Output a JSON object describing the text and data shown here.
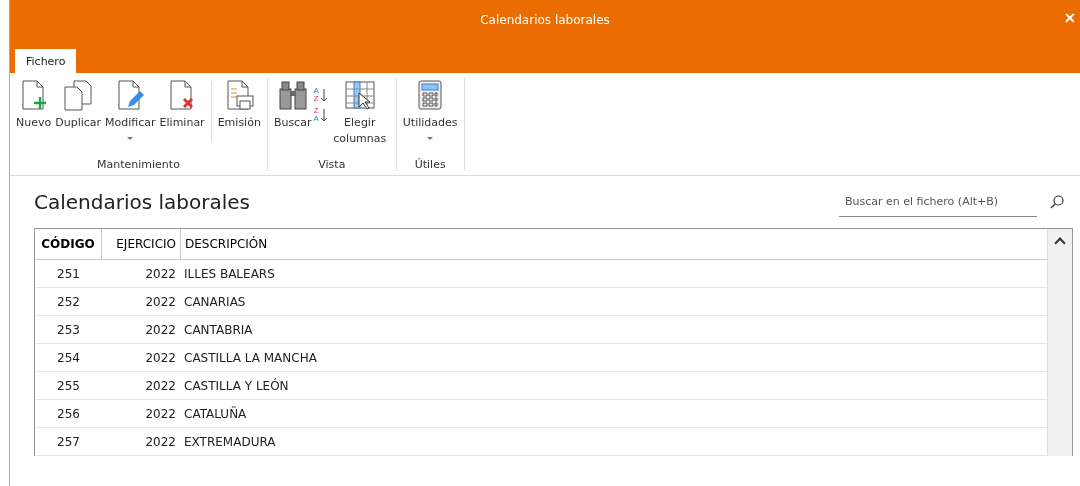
{
  "window": {
    "title": "Calendarios laborales",
    "close": "✕"
  },
  "tabs": [
    {
      "label": "Fichero",
      "selected": true
    }
  ],
  "ribbon": {
    "groups": [
      {
        "label": "Mantenimiento",
        "buttons": [
          {
            "label": "Nuevo",
            "kind": "new"
          },
          {
            "label": "Duplicar",
            "kind": "duplicate"
          },
          {
            "label": "Modificar",
            "kind": "edit",
            "dropdown": true
          },
          {
            "label": "Eliminar",
            "kind": "delete"
          },
          {
            "label": "Emisión",
            "kind": "print",
            "separated": true
          }
        ]
      },
      {
        "label": "Vista",
        "buttons": [
          {
            "label": "Buscar",
            "kind": "binoculars"
          },
          {
            "kind": "sort",
            "letters": [
              [
                "A",
                "Z"
              ],
              [
                "Z",
                "A"
              ]
            ]
          },
          {
            "label": "Elegir columnas",
            "kind": "columns"
          }
        ]
      },
      {
        "label": "Útiles",
        "buttons": [
          {
            "label": "Utilidades",
            "kind": "calculator",
            "dropdown": true
          }
        ]
      }
    ]
  },
  "page": {
    "title": "Calendarios laborales",
    "search": {
      "placeholder": "Buscar en el fichero (Alt+B)"
    }
  },
  "table": {
    "columns": [
      "CÓDIGO",
      "EJERCICIO",
      "DESCRIPCIÓN"
    ],
    "rows": [
      [
        "251",
        "2022",
        "ILLES BALEARS"
      ],
      [
        "252",
        "2022",
        "CANARIAS"
      ],
      [
        "253",
        "2022",
        "CANTABRIA"
      ],
      [
        "254",
        "2022",
        "CASTILLA LA MANCHA"
      ],
      [
        "255",
        "2022",
        "CASTILLA Y LEÓN"
      ],
      [
        "256",
        "2022",
        "CATALUÑA"
      ],
      [
        "257",
        "2022",
        "EXTREMADURA"
      ]
    ]
  }
}
